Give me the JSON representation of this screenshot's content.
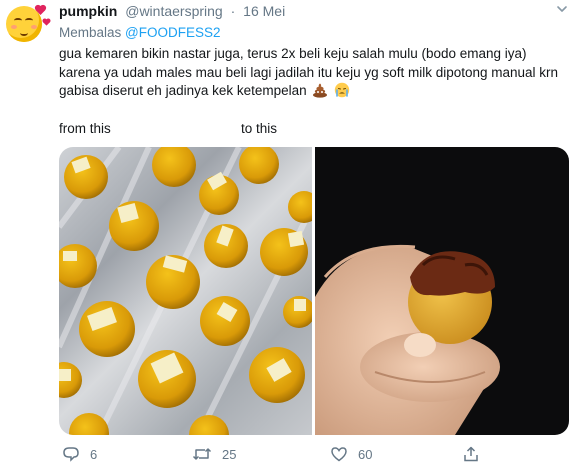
{
  "tweet": {
    "display_name": "pumpkin",
    "handle": "@wintaerspring",
    "separator": "·",
    "date": "16 Mei",
    "reply_prefix": "Membalas",
    "reply_mention": "@FOODFESS2",
    "text": "gua kemaren bikin nastar juga, terus 2x beli keju salah mulu (bodo emang iya) karena ya udah males mau beli lagi jadilah itu keju yg soft milk dipotong manual krn gabisa diserut eh jadinya kek ketempelan",
    "text_emojis": [
      "pile-of-poo-emoji",
      "crying-face-emoji"
    ],
    "caption_from": "from this",
    "caption_to": "to this",
    "photos": [
      "nastar-tray-photo",
      "nastar-in-hand-photo"
    ]
  },
  "actions": {
    "replies": "6",
    "retweets": "25",
    "likes": "60"
  },
  "colors": {
    "link": "#1da1f2",
    "muted": "#657786",
    "text": "#14171a"
  }
}
